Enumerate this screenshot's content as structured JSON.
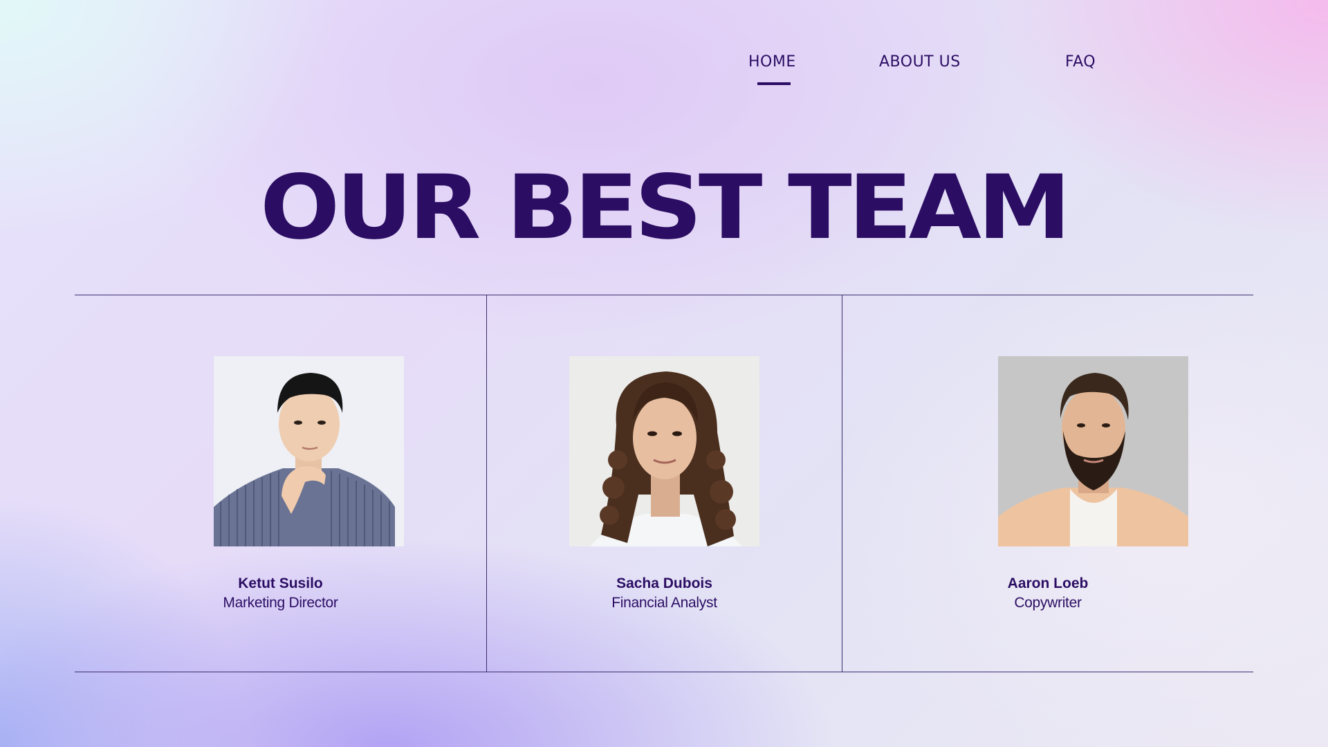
{
  "nav": {
    "items": [
      {
        "label": "HOME",
        "active": true
      },
      {
        "label": "ABOUT US",
        "active": false
      },
      {
        "label": "FAQ",
        "active": false
      }
    ]
  },
  "heading": {
    "title": "OUR BEST TEAM"
  },
  "team": {
    "members": [
      {
        "name": "Ketut Susilo",
        "role": "Marketing Director"
      },
      {
        "name": "Sacha Dubois",
        "role": "Financial Analyst"
      },
      {
        "name": "Aaron Loeb",
        "role": "Copywriter"
      }
    ]
  },
  "colors": {
    "primary_text": "#2b0d63",
    "rule_lines": "#3c2a6e"
  }
}
